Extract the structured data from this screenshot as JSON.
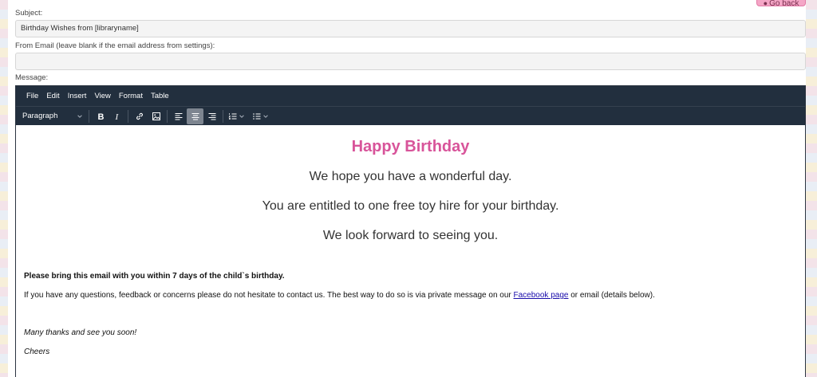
{
  "header": {
    "go_back_label": "Go back"
  },
  "form": {
    "subject_label": "Subject:",
    "subject_value": "Birthday Wishes from [libraryname]",
    "from_email_label": "From Email (leave blank if the email address from settings):",
    "from_email_value": "",
    "message_label": "Message:"
  },
  "editor": {
    "menu": [
      "File",
      "Edit",
      "Insert",
      "View",
      "Format",
      "Table"
    ],
    "block_format": "Paragraph",
    "toolbar_icons": [
      "bold-icon",
      "italic-icon",
      "link-icon",
      "image-icon",
      "align-left-icon",
      "align-center-icon",
      "align-right-icon",
      "numbered-list-icon",
      "bullet-list-icon"
    ],
    "active_alignment": "center",
    "content": {
      "heading": "Happy Birthday",
      "line1": "We hope you have a wonderful day.",
      "line2": "You are entitled to one free toy hire for your birthday.",
      "line3": "We look forward to seeing you.",
      "bold_note": "Please bring this email with you within 7 days of the child`s birthday.",
      "contact_before": "If you have any questions, feedback or concerns please do not hesitate to contact us. The best way to do so is via private message on our ",
      "contact_link": "Facebook page",
      "contact_after": " or email (details below).",
      "thanks": "Many thanks and see you soon!",
      "signoff": "Cheers"
    }
  },
  "colors": {
    "accent": "#d8549a",
    "toolbar_bg": "#222f3e",
    "link": "#1a0dab"
  }
}
